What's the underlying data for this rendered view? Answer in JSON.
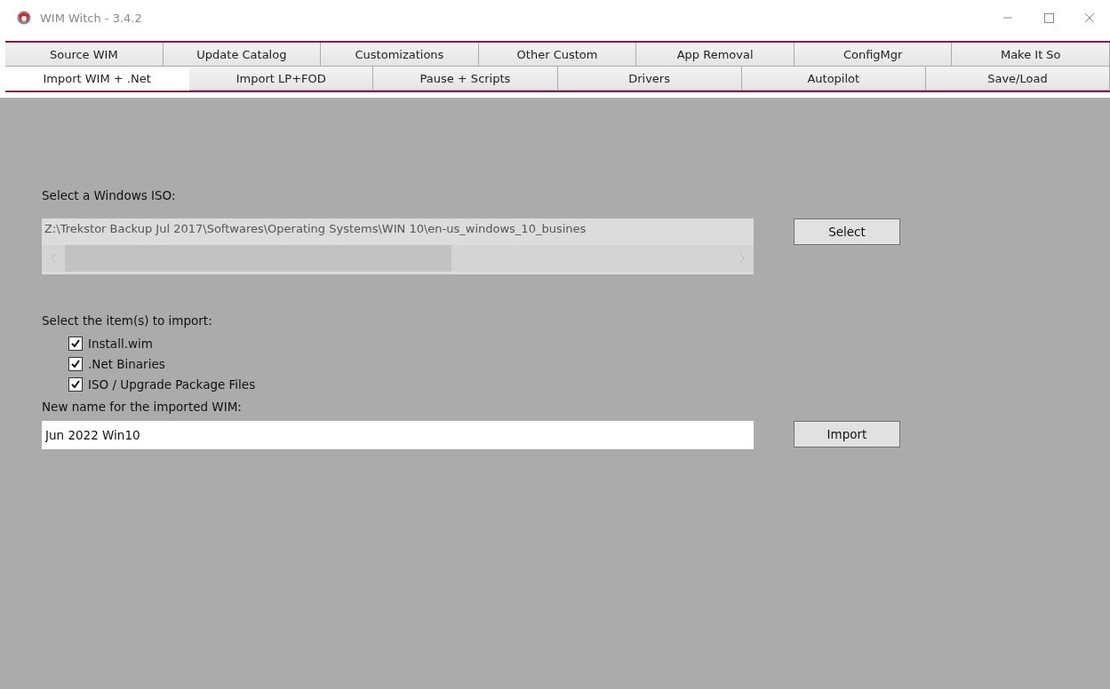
{
  "window": {
    "title": "WIM Witch - 3.4.2"
  },
  "tab_rows": [
    {
      "tabs": [
        {
          "label": "Source WIM",
          "selected": false
        },
        {
          "label": "Update Catalog",
          "selected": false
        },
        {
          "label": "Customizations",
          "selected": false
        },
        {
          "label": "Other Custom",
          "selected": false
        },
        {
          "label": "App Removal",
          "selected": false
        },
        {
          "label": "ConfigMgr",
          "selected": false
        },
        {
          "label": "Make It So",
          "selected": false
        }
      ]
    },
    {
      "tabs": [
        {
          "label": "Import WIM + .Net",
          "selected": true
        },
        {
          "label": "Import LP+FOD",
          "selected": false
        },
        {
          "label": "Pause + Scripts",
          "selected": false
        },
        {
          "label": "Drivers",
          "selected": false
        },
        {
          "label": "Autopilot",
          "selected": false
        },
        {
          "label": "Save/Load",
          "selected": false
        }
      ]
    }
  ],
  "iso": {
    "label": "Select a Windows ISO:",
    "value": "Z:\\Trekstor Backup Jul 2017\\Softwares\\Operating Systems\\WIN 10\\en-us_windows_10_busines",
    "button": "Select"
  },
  "import_items": {
    "label": "Select the item(s) to import:",
    "items": [
      {
        "label": "Install.wim",
        "checked": true
      },
      {
        "label": ".Net Binaries",
        "checked": true
      },
      {
        "label": "ISO / Upgrade Package Files",
        "checked": true
      }
    ]
  },
  "new_name": {
    "label": "New name for the imported WIM:",
    "value": "Jun 2022 Win10",
    "button": "Import"
  }
}
